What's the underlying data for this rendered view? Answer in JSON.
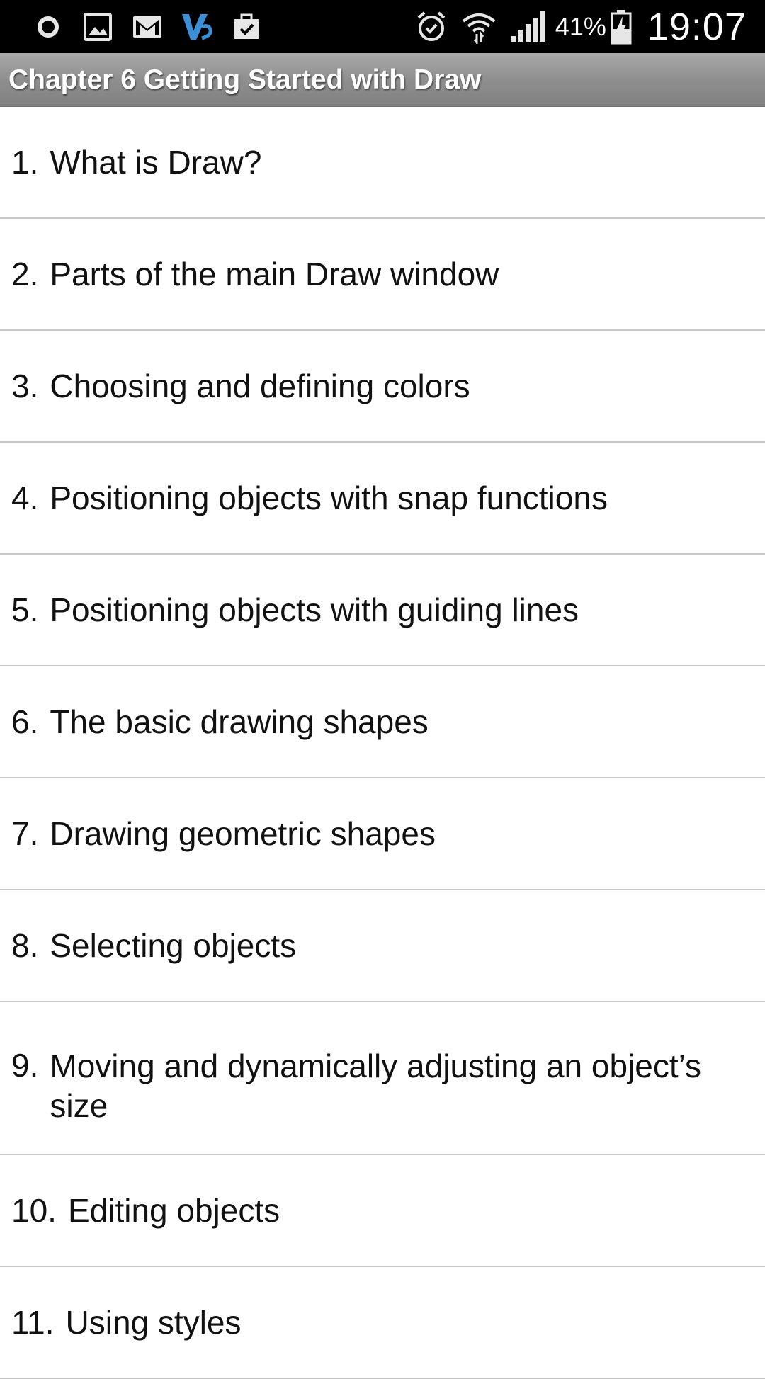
{
  "status_bar": {
    "left_icons": [
      "record-icon",
      "image-icon",
      "gmail-icon",
      "vs-app-icon",
      "briefcase-check-icon"
    ],
    "right_icons": [
      "alarm-icon",
      "wifi-icon",
      "signal-icon",
      "battery-charging-icon"
    ],
    "battery_percent": "41%",
    "time": "19:07"
  },
  "header": {
    "title": "Chapter 6 Getting Started with Draw"
  },
  "toc": {
    "items": [
      {
        "num": "1.",
        "label": "What is Draw?"
      },
      {
        "num": "2.",
        "label": "Parts of the main Draw window"
      },
      {
        "num": "3.",
        "label": "Choosing and defining colors"
      },
      {
        "num": "4.",
        "label": "Positioning objects with snap functions"
      },
      {
        "num": "5.",
        "label": "Positioning objects with guiding lines"
      },
      {
        "num": "6.",
        "label": "The basic drawing shapes"
      },
      {
        "num": "7.",
        "label": "Drawing geometric shapes"
      },
      {
        "num": "8.",
        "label": "Selecting objects"
      },
      {
        "num": "9.",
        "label": "Moving and dynamically adjusting an object’s size"
      },
      {
        "num": "10.",
        "label": "Editing objects"
      },
      {
        "num": "11.",
        "label": "Using styles"
      }
    ]
  }
}
